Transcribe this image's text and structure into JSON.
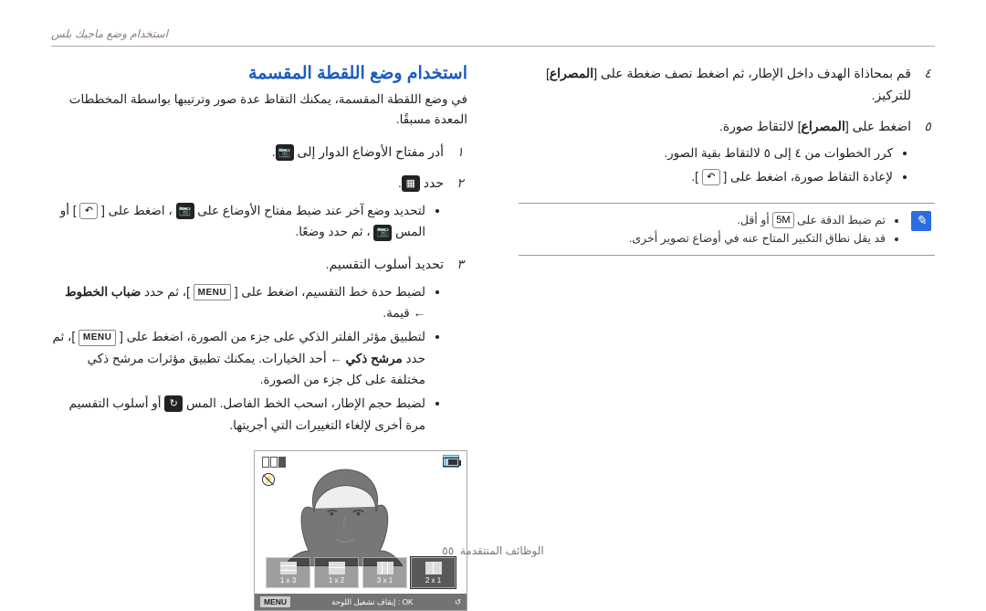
{
  "breadcrumb": "استخدام وضع ماجيك بلس",
  "title": "استخدام وضع اللقطة المقسمة",
  "intro": "في وضع اللقطة المقسمة، يمكنك التقاط عدة صور وترتيبها بواسطة المخططات المعدة مسبقًا.",
  "steps_right": {
    "s1": {
      "n": "١",
      "pre": "أدر مفتاح الأوضاع الدوار إلى ",
      "icon": "camera-icon"
    },
    "s2": {
      "n": "٢",
      "pre": "حدد ",
      "icon": "split-icon"
    },
    "s2b": {
      "li1_a": "لتحديد وضع آخر عند ضبط مفتاح الأوضاع على ",
      "li1_b": "، اضغط على [",
      "li1_c": "] أو المس ",
      "li1_d": "، ثم حدد وضعًا."
    },
    "s3": {
      "n": "٣",
      "text": "تحديد أسلوب التقسيم."
    },
    "s3b": {
      "li1_a": "لضبط حدة خط التقسيم، اضغط على [",
      "li1_b": "]، ثم حدد ",
      "li1_bold": "ضباب الخطوط",
      "li1_c": " ← قيمة.",
      "li2_a": "لتطبيق مؤثر الفلتر الذكي على جزء من الصورة، اضغط على [",
      "li2_b": "]، ثم حدد ",
      "li2_bold": "مرشح ذكي",
      "li2_c": " ← أحد الخيارات. يمكنك تطبيق مؤثرات مرشح ذكي مختلفة على كل جزء من الصورة.",
      "li3_a": "لضبط حجم الإطار، اسحب الخط الفاصل. المس ",
      "li3_b": " أو أسلوب التقسيم مرة أخرى لإلغاء التغييرات التي أجريتها."
    }
  },
  "steps_left": {
    "s4": {
      "n": "٤",
      "a": "قم بمحاذاة الهدف داخل الإطار، ثم اضغط نصف ضغطة على [",
      "bold": "المصراع",
      "c": "] للتركيز."
    },
    "s5": {
      "n": "٥",
      "a": "اضغط على [",
      "bold": "المصراع",
      "c": "] لالتقاط صورة."
    },
    "s5b": {
      "li1": "كرر الخطوات من ٤ إلى ٥ لالتقاط بقية الصور.",
      "li2": "لإعادة التقاط صورة، اضغط على [",
      "li2b": "]."
    }
  },
  "note": {
    "li1a": "تم ضبط الدقة على ",
    "li1b": " أو أقل.",
    "li2": "قد يقل نطاق التكبير المتاح عنه في أوضاع تصوير أخرى."
  },
  "camera": {
    "opts": [
      {
        "label": "2 x 1"
      },
      {
        "label": "3 x 1"
      },
      {
        "label": "1 x 2"
      },
      {
        "label": "1 x 3"
      }
    ],
    "menu": "MENU",
    "pause": "إيقاف تشغيل اللوحة",
    "ok": "OK"
  },
  "icons": {
    "camera": "📷",
    "split": "▦",
    "back": "↶",
    "loop": "↻",
    "size": "5M"
  },
  "menu_label": "MENU",
  "footer": {
    "page": "٥٥",
    "section": "الوظائف المنتقدمة"
  }
}
